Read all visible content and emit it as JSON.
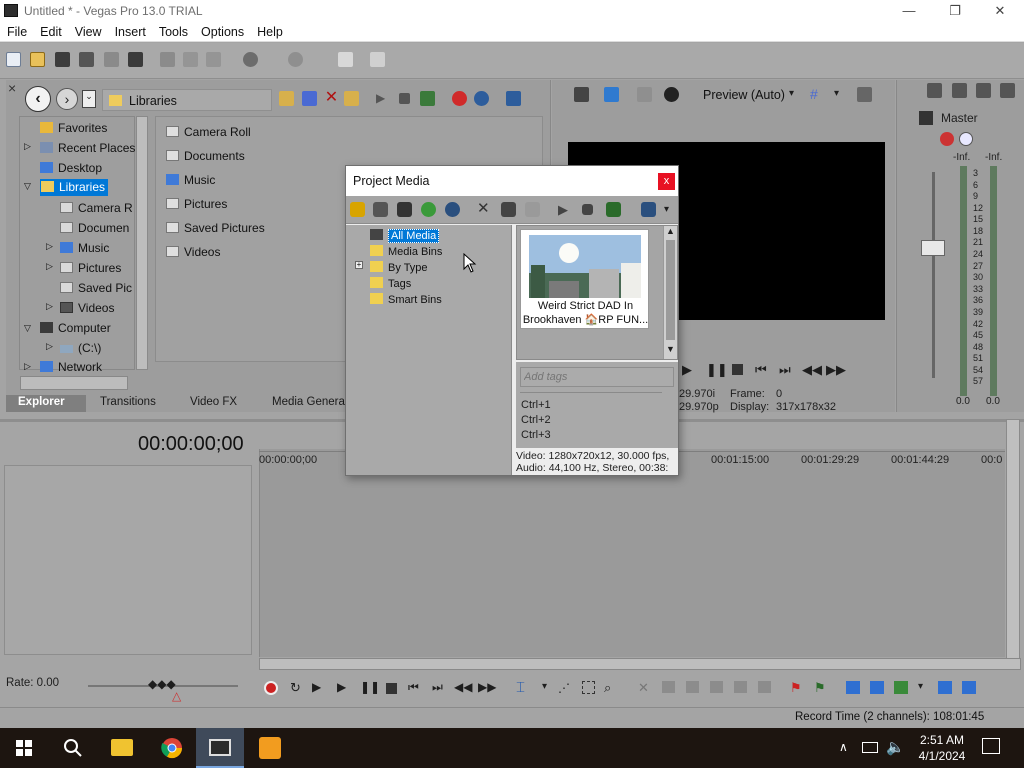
{
  "window": {
    "title": "Untitled * - Vegas Pro 13.0 TRIAL",
    "minimize": "—",
    "maximize": "❐",
    "close": "✕"
  },
  "menu": [
    "File",
    "Edit",
    "View",
    "Insert",
    "Tools",
    "Options",
    "Help"
  ],
  "explorer": {
    "location": "Libraries",
    "tree": [
      "Favorites",
      "Recent Places",
      "Desktop",
      "Libraries",
      "Camera R",
      "Documen",
      "Music",
      "Pictures",
      "Saved Pic",
      "Videos",
      "Computer",
      "(C:\\)",
      "Network"
    ],
    "files": [
      "Camera Roll",
      "Documents",
      "Music",
      "Pictures",
      "Saved Pictures",
      "Videos"
    ],
    "tabs": [
      "Explorer",
      "Transitions",
      "Video FX",
      "Media Generato"
    ]
  },
  "preview": {
    "mode": "Preview (Auto)",
    "project_label": "29.970i",
    "preview_label": "29.970p",
    "frame_label": "Frame:",
    "frame_value": "0",
    "display_label": "Display:",
    "display_value": "317x178x32"
  },
  "mixer": {
    "master": "Master",
    "inf_left": "-Inf.",
    "inf_right": "-Inf.",
    "scale": [
      "3",
      "6",
      "9",
      "12",
      "15",
      "18",
      "21",
      "24",
      "27",
      "30",
      "33",
      "36",
      "39",
      "42",
      "45",
      "48",
      "51",
      "54",
      "57"
    ],
    "val_left": "0.0",
    "val_right": "0.0"
  },
  "timeline": {
    "timecode": "00:00:00;00",
    "ruler": [
      "00:00:00;00",
      "00:01:15:00",
      "00:01:29:29",
      "00:01:44:29",
      "00:0"
    ],
    "rate": "Rate: 0.00",
    "record_time": "Record Time (2 channels): 108:01:45"
  },
  "dialog": {
    "title": "Project Media",
    "close": "x",
    "tree": [
      "All Media",
      "Media Bins",
      "By Type",
      "Tags",
      "Smart Bins"
    ],
    "media_caption_1": "Weird Strict DAD In",
    "media_caption_2": "Brookhaven 🏠RP FUN...",
    "tags_placeholder": "Add tags",
    "shortcuts": [
      "Ctrl+1",
      "Ctrl+2",
      "Ctrl+3"
    ],
    "info_video": "Video: 1280x720x12, 30.000 fps,",
    "info_audio": "Audio: 44,100 Hz, Stereo, 00:38:"
  },
  "taskbar": {
    "time": "2:51 AM",
    "date": "4/1/2024"
  },
  "colors": {
    "accent": "#0078d7",
    "dialog_close": "#e81123",
    "timeline_bg": "#9a9a9a",
    "preview_bg": "#000000"
  }
}
